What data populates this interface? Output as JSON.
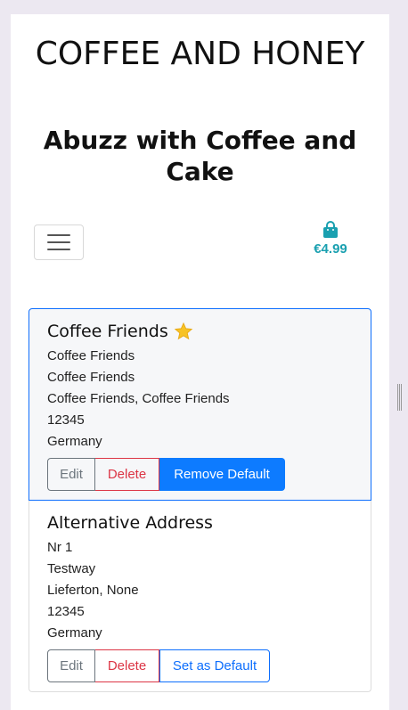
{
  "header": {
    "title": "COFFEE AND HONEY",
    "subtitle": "Abuzz with Coffee and Cake"
  },
  "nav": {
    "toggle_icon": "hamburger-icon"
  },
  "cart": {
    "icon": "shopping-bag-icon",
    "total": "€4.99",
    "color": "#1aa0b0"
  },
  "addresses": [
    {
      "name": "Coffee Friends",
      "is_default": true,
      "default_icon": "star-icon",
      "lines": [
        "Coffee Friends",
        "Coffee Friends",
        "Coffee Friends, Coffee Friends",
        "12345",
        "Germany"
      ],
      "buttons": {
        "edit": "Edit",
        "delete": "Delete",
        "default_action": "Remove Default"
      }
    },
    {
      "name": "Alternative Address",
      "is_default": false,
      "lines": [
        "Nr 1",
        "Testway",
        "Lieferton, None",
        "12345",
        "Germany"
      ],
      "buttons": {
        "edit": "Edit",
        "delete": "Delete",
        "default_action": "Set as Default"
      }
    }
  ],
  "colors": {
    "primary": "#0d7bff",
    "danger": "#dc3545",
    "secondary": "#6c757d",
    "page_background": "#ece8f1"
  }
}
